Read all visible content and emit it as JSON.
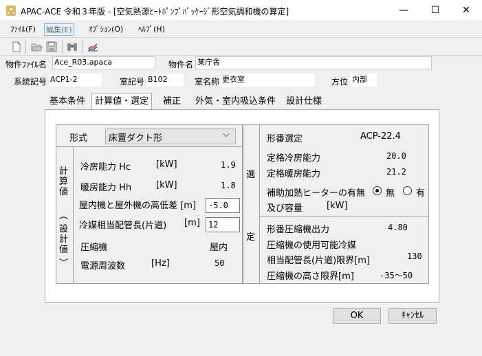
{
  "window": {
    "title": "APAC-ACE 令和３年版 - [空気熱源ﾋｰﾄﾎﾟﾝﾌﾟﾊﾟｯｹｰｼﾞ形空気調和機の算定]",
    "minimize": "—",
    "maximize": "☐",
    "close": "✕"
  },
  "menu": {
    "file": "ﾌｧｲﾙ(F)",
    "edit": "編集(E)",
    "options": "ｵﾌﾟｼｮﾝ(O)",
    "help": "ﾍﾙﾌﾟ(H)"
  },
  "toolbar": {
    "icons": [
      "new-file-icon",
      "open-folder-icon",
      "save-icon",
      "binoculars-icon",
      "chart-icon"
    ]
  },
  "file_info": {
    "property_file_label": "物件ﾌｧｲﾙ名",
    "property_file_value": "Ace_R03.apaca",
    "property_name_label": "物件名",
    "property_name_value": "某庁舎"
  },
  "system_info": {
    "system_code_label": "系統記号",
    "system_code_value": "ACP1-2",
    "room_code_label": "室記号",
    "room_code_value": "B102",
    "room_name_label": "室名称",
    "room_name_value": "更衣室",
    "orientation_label": "方位",
    "orientation_value": "内部"
  },
  "tabs": [
    "基本条件",
    "計算値・選定",
    "補正",
    "外気・室内吸込条件",
    "設計仕様"
  ],
  "left_group": {
    "form_label": "形式",
    "form_value": "床置ダクト形",
    "dropdown_arrow": "⌵",
    "side_title": [
      "計",
      "算",
      "値",
      "︵",
      "設",
      "計",
      "値",
      "︶"
    ],
    "cooling_label": "冷房能力 Hc",
    "cooling_unit": "[kW]",
    "cooling_value": "1.9",
    "heating_label": "暖房能力 Hh",
    "heating_unit": "[kW]",
    "heating_value": "1.8",
    "height_diff_label": "屋内機と屋外機の高低差 [m]",
    "height_diff_value": "-5.0",
    "pipe_length_label": "冷媒相当配管長(片道)",
    "pipe_length_unit": "[m]",
    "pipe_length_value": "12",
    "compressor_label": "圧縮機",
    "compressor_value": "屋内",
    "frequency_label": "電源周波数",
    "frequency_unit": "[Hz]",
    "frequency_value": "50"
  },
  "right_group": {
    "side_top": "選",
    "side_bottom": "定",
    "model_label": "形番選定",
    "model_value": "ACP-22.4",
    "rated_cooling_label": "定格冷房能力",
    "rated_cooling_value": "20.0",
    "rated_heating_label": "定格暖房能力",
    "rated_heating_value": "21.2",
    "heater_label": "補助加熱ヒーターの有無",
    "heater_none": "無",
    "heater_yes": "有",
    "heater_selected": "無",
    "capacity_label": "及び容量",
    "capacity_unit": "[kW]",
    "compressor_output_label": "形番圧縮機出力",
    "compressor_output_value": "4.80",
    "usable_label_1": "圧縮機の使用可能冷媒",
    "usable_label_2": "相当配管長(片道)限界[m]",
    "usable_value": "130",
    "height_limit_label": "圧縮機の高さ限界[m]",
    "height_limit_value": "-35～50"
  },
  "buttons": {
    "ok": "OK",
    "cancel": "ｷｬﾝｾﾙ"
  }
}
